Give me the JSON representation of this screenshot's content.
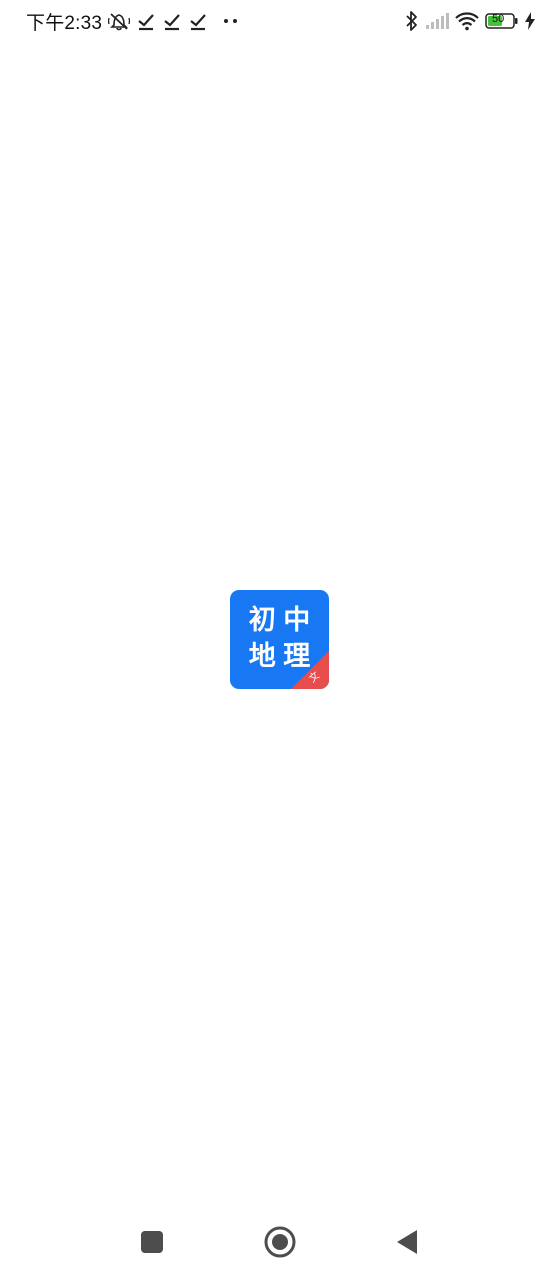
{
  "status_bar": {
    "time": "下午2:33",
    "battery_level": "50",
    "icons_left": [
      "mute-icon",
      "check-icon",
      "check-icon",
      "check-icon",
      "more-dots-icon"
    ],
    "icons_right": [
      "bluetooth-icon",
      "signal-icon",
      "wifi-icon",
      "battery-icon",
      "charging-icon"
    ]
  },
  "app_icon": {
    "chars": [
      "初",
      "中",
      "地",
      "理"
    ],
    "corner_label": "文",
    "primary_color": "#1877f2",
    "accent_color": "#e74d4d"
  },
  "nav_bar": {
    "buttons": [
      "recent-apps",
      "home",
      "back"
    ]
  }
}
